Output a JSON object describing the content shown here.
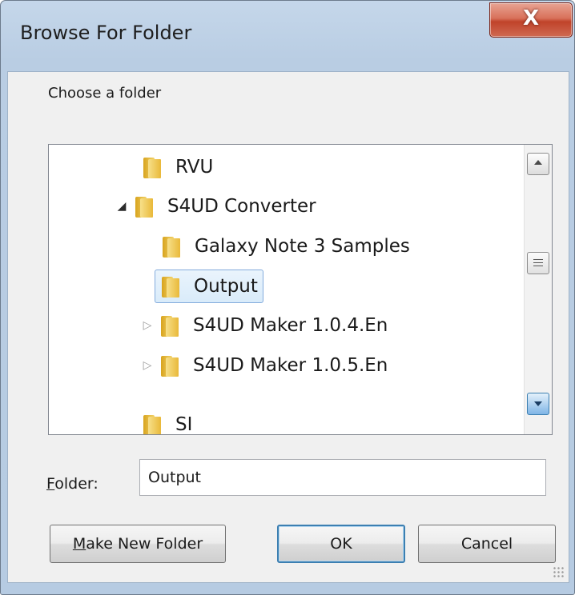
{
  "window": {
    "title": "Browse For Folder",
    "close_glyph": "X"
  },
  "prompt": "Choose a folder",
  "tree": {
    "items": [
      {
        "label": "RVU",
        "expander": "",
        "icon": "folder-icon",
        "selected": false
      },
      {
        "label": "S4UD Converter",
        "expander": "◢",
        "icon": "folder-icon",
        "selected": false
      },
      {
        "label": "Galaxy Note 3 Samples",
        "expander": "",
        "icon": "folder-icon",
        "selected": false
      },
      {
        "label": "Output",
        "expander": "",
        "icon": "folder-icon",
        "selected": true
      },
      {
        "label": "S4UD Maker 1.0.4.En",
        "expander": "▷",
        "icon": "folder-icon",
        "selected": false
      },
      {
        "label": "S4UD Maker 1.0.5.En",
        "expander": "▷",
        "icon": "folder-icon",
        "selected": false
      },
      {
        "label": "SI",
        "expander": "",
        "icon": "folder-icon",
        "selected": false
      }
    ]
  },
  "folder_field": {
    "label_mnemonic": "F",
    "label_rest": "older:",
    "value": "Output"
  },
  "buttons": {
    "make_new_folder_mnemonic": "M",
    "make_new_folder_rest": "ake New Folder",
    "ok": "OK",
    "cancel": "Cancel"
  },
  "colors": {
    "title_bar": "#b9cde3",
    "close_button": "#c0432a",
    "selection_border": "#84acdd",
    "default_button_border": "#3c7fb1"
  }
}
